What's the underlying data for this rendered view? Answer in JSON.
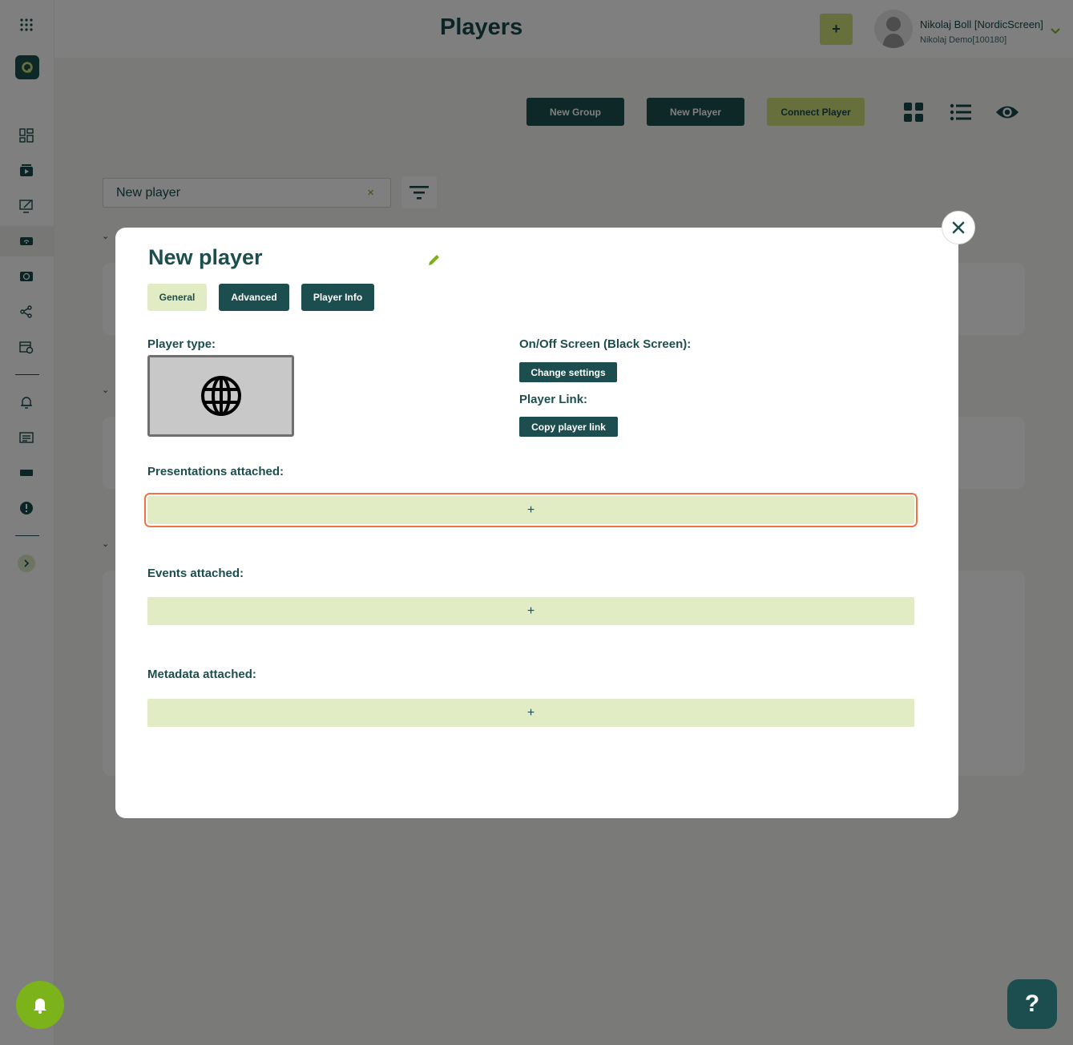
{
  "header": {
    "title": "Players",
    "add_label": "+",
    "user_name": "Nikolaj Boll [NordicScreen]",
    "user_account": "Nikolaj Demo[100180]"
  },
  "toolbar": {
    "new_group": "New Group",
    "new_player": "New Player",
    "connect_player": "Connect Player"
  },
  "search": {
    "value": "New player",
    "clear_icon": "×"
  },
  "sidebar": {
    "icons": [
      "apps-grid-icon",
      "dashboard-icon",
      "media-icon",
      "presentation-edit-icon",
      "players-icon",
      "playlist-icon",
      "share-icon",
      "calendar-icon",
      "alarm-icon",
      "news-icon",
      "ticker-icon",
      "alert-icon",
      "expand-icon"
    ]
  },
  "modal": {
    "title": "New player",
    "tabs": [
      "General",
      "Advanced",
      "Player Info"
    ],
    "player_type_label": "Player type:",
    "onoff_label": "On/Off Screen (Black Screen):",
    "change_settings": "Change settings",
    "player_link_label": "Player Link:",
    "copy_link": "Copy player link",
    "presentations_label": "Presentations attached:",
    "events_label": "Events attached:",
    "metadata_label": "Metadata attached:",
    "add_symbol": "+"
  },
  "fab": {
    "help": "?"
  },
  "colors": {
    "primary": "#1d4e4f",
    "accent": "#cfe07a",
    "light_accent": "#e1ebc4",
    "focus": "#f07443",
    "bell": "#7db31a"
  }
}
